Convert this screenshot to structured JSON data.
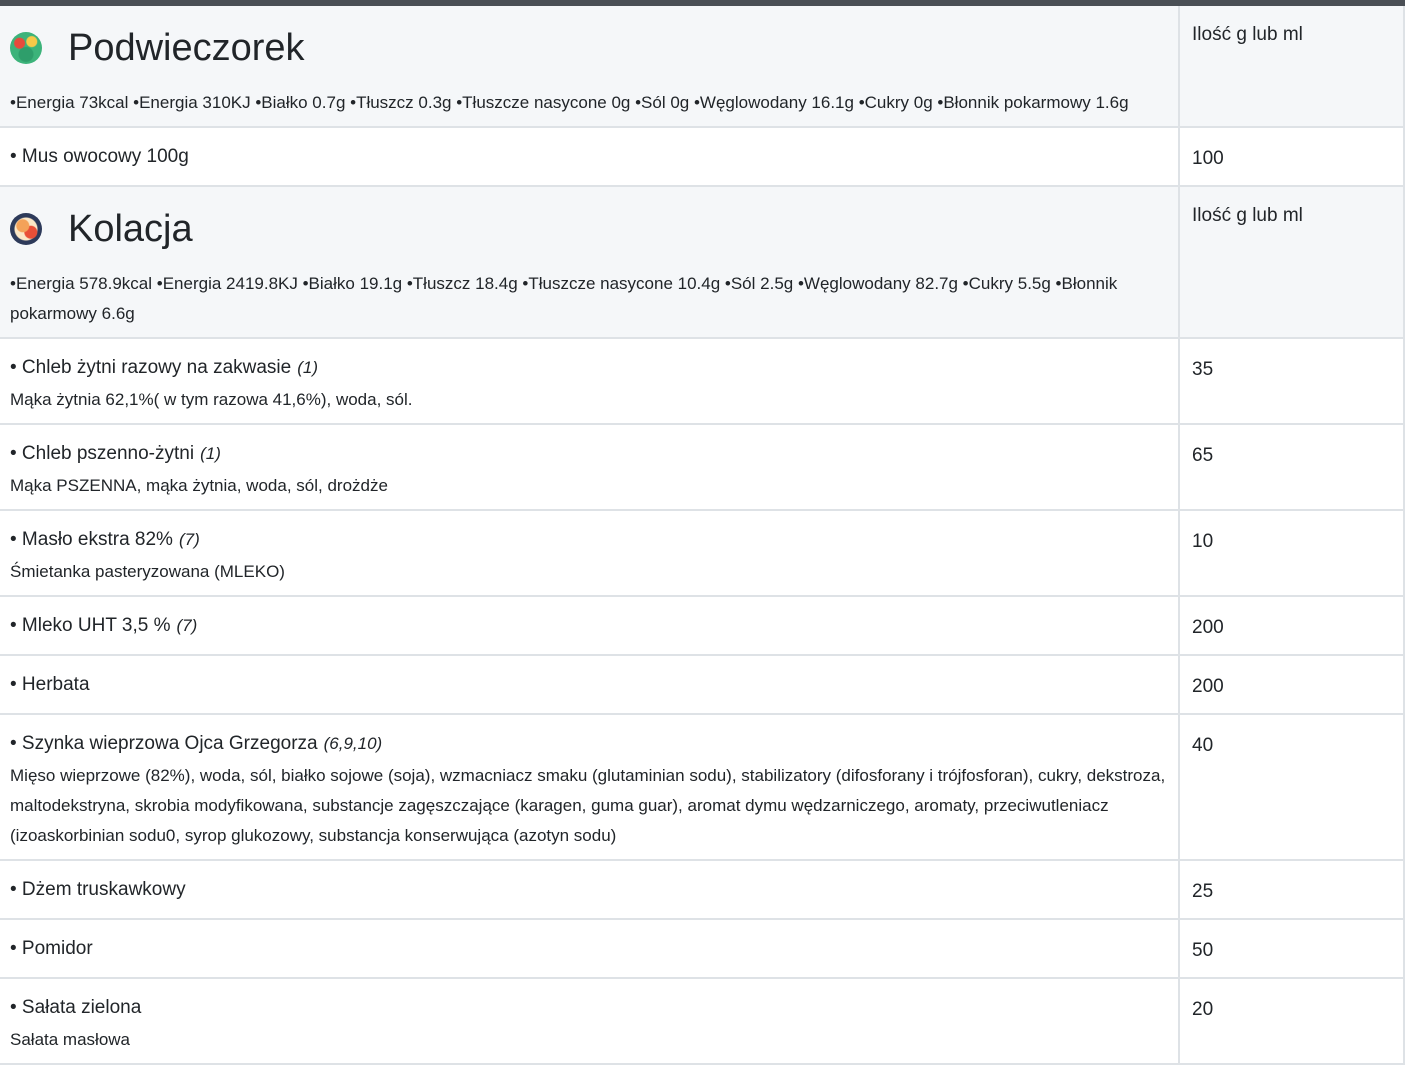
{
  "qty_header": "Ilość g lub ml",
  "meals": [
    {
      "title": "Podwieczorek",
      "nutrition": "•Energia 73kcal •Energia 310KJ •Białko 0.7g •Tłuszcz 0.3g •Tłuszcze nasycone 0g •Sól 0g •Węglowodany 16.1g •Cukry 0g •Błonnik pokarmowy 1.6g",
      "items": [
        {
          "name": "• Mus owocowy 100g",
          "allergens": "",
          "desc": "",
          "qty": "100"
        }
      ]
    },
    {
      "title": "Kolacja",
      "nutrition": "•Energia 578.9kcal •Energia 2419.8KJ •Białko 19.1g •Tłuszcz 18.4g •Tłuszcze nasycone 10.4g •Sól 2.5g •Węglowodany 82.7g •Cukry 5.5g •Błonnik pokarmowy 6.6g",
      "items": [
        {
          "name": "• Chleb żytni razowy na zakwasie",
          "allergens": "(1)",
          "desc": "Mąka żytnia 62,1%( w tym razowa 41,6%), woda, sól.",
          "qty": "35"
        },
        {
          "name": "• Chleb pszenno-żytni",
          "allergens": "(1)",
          "desc": "Mąka PSZENNA, mąka żytnia, woda, sól, drożdże",
          "qty": "65"
        },
        {
          "name": "• Masło ekstra 82%",
          "allergens": "(7)",
          "desc": "Śmietanka pasteryzowana (MLEKO)",
          "qty": "10"
        },
        {
          "name": "• Mleko UHT 3,5 %",
          "allergens": "(7)",
          "desc": "",
          "qty": "200"
        },
        {
          "name": "• Herbata",
          "allergens": "",
          "desc": "",
          "qty": "200"
        },
        {
          "name": "• Szynka wieprzowa Ojca Grzegorza",
          "allergens": "(6,9,10)",
          "desc": "Mięso wieprzowe (82%), woda, sól, białko sojowe (soja), wzmacniacz smaku (glutaminian sodu), stabilizatory (difosforany i trójfosforan), cukry, dekstroza, maltodekstryna, skrobia modyfikowana, substancje zagęszczające (karagen, guma guar), aromat dymu wędzarniczego, aromaty, przeciwutleniacz (izoaskorbinian sodu0, syrop glukozowy, substancja konserwująca (azotyn sodu)",
          "qty": "40"
        },
        {
          "name": "• Dżem truskawkowy",
          "allergens": "",
          "desc": "",
          "qty": "25"
        },
        {
          "name": "• Pomidor",
          "allergens": "",
          "desc": "",
          "qty": "50"
        },
        {
          "name": "• Sałata zielona",
          "allergens": "",
          "desc": "Sałata masłowa",
          "qty": "20"
        }
      ]
    }
  ],
  "icons": [
    "podwieczorek-meal-icon",
    "kolacja-meal-icon"
  ]
}
